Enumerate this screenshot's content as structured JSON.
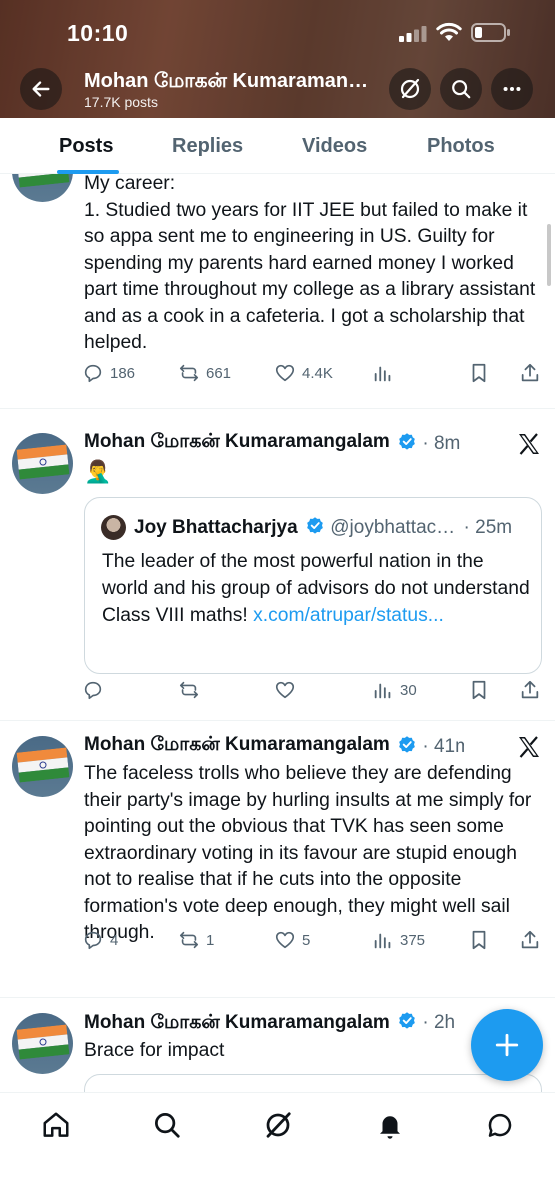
{
  "status_bar": {
    "time": "10:10"
  },
  "profile": {
    "name": "Mohan மோகன் Kumaramangalam",
    "posts_count": "17.7K posts"
  },
  "tabs": [
    {
      "label": "Posts",
      "active": true
    },
    {
      "label": "Replies",
      "active": false
    },
    {
      "label": "Videos",
      "active": false
    },
    {
      "label": "Photos",
      "active": false
    }
  ],
  "posts": [
    {
      "text": "My career:\n1. Studied two years for IIT JEE but failed to make it so appa sent me to engineering in US. Guilty for spending my parents hard earned money I worked part time throughout my college as a library assistant and as a cook in a cafeteria. I got a scholarship that helped.",
      "replies": "186",
      "reposts": "661",
      "likes": "4.4K",
      "views": ""
    },
    {
      "author": "Mohan மோகன் Kumaramangalam",
      "time": "8m",
      "emoji": "🤦‍♂️",
      "quote": {
        "author": "Joy Bhattacharjya",
        "handle": "@joybhattacharjya",
        "time": "25m",
        "text": "The leader of the most powerful nation in the world and his group of advisors do not understand Class VIII maths! ",
        "link": "x.com/atrupar/status..."
      },
      "replies": "",
      "reposts": "",
      "likes": "",
      "views": "30"
    },
    {
      "author": "Mohan மோகன் Kumaramangalam",
      "time": "41m",
      "text": "The faceless trolls who believe they are defending their party's image by hurling insults at me simply for pointing out the obvious that TVK has seen some extraordinary voting in its favour are stupid enough not to realise that if he cuts into the opposite formation's vote deep enough, they might well sail through.",
      "replies": "4",
      "reposts": "1",
      "likes": "5",
      "views": "375"
    },
    {
      "author": "Mohan மோகன் Kumaramangalam",
      "time": "2h",
      "text": "Brace for impact"
    }
  ],
  "colors": {
    "accent": "#1d9bf0",
    "text": "#0f1419",
    "muted": "#536471"
  },
  "icons": [
    "back-arrow-icon",
    "grok-icon",
    "search-icon",
    "more-icon",
    "reply-icon",
    "repost-icon",
    "like-icon",
    "views-icon",
    "bookmark-icon",
    "share-icon",
    "x-logo-icon",
    "compose-plus-icon",
    "home-icon",
    "notifications-icon",
    "messages-icon"
  ]
}
